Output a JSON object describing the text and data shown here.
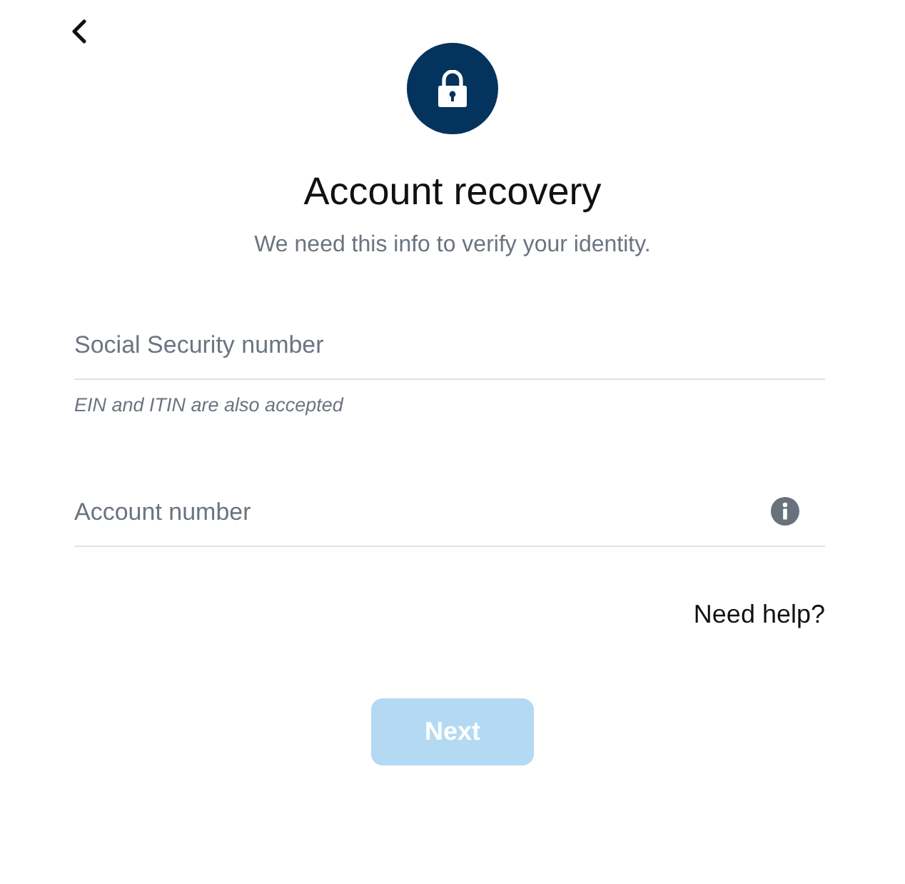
{
  "title": "Account recovery",
  "subtitle": "We need this info to verify your identity.",
  "fields": [
    {
      "placeholder": "Social Security number",
      "hint": "EIN and ITIN are also accepted",
      "info": false
    },
    {
      "placeholder": "Account number",
      "info": true
    }
  ],
  "help_link": "Need help?",
  "next_button": {
    "label": "Next",
    "disabled": true
  }
}
